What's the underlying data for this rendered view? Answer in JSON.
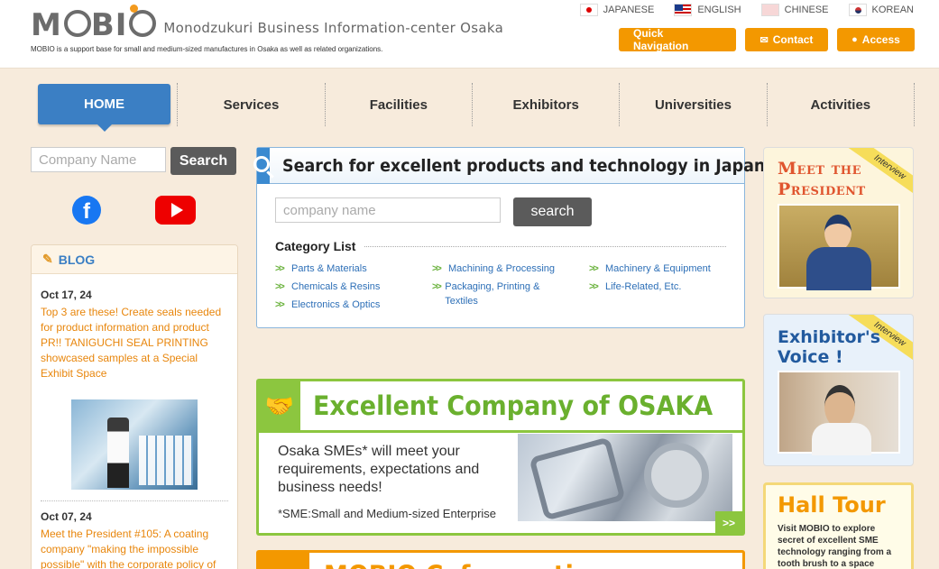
{
  "header": {
    "logo_text": "MOBIO",
    "org_name": "Monodzukuri Business Information-center Osaka",
    "tagline": "MOBIO is a support base for small and medium-sized manufactures in Osaka as well as related organizations.",
    "languages": [
      {
        "label": "JAPANESE",
        "flag": "jp-flag-icon"
      },
      {
        "label": "ENGLISH",
        "flag": "us-flag-icon"
      },
      {
        "label": "CHINESE",
        "flag": "cn-flag-icon"
      },
      {
        "label": "KOREAN",
        "flag": "kr-flag-icon"
      }
    ],
    "buttons": {
      "quick_nav": "Quick Navigation",
      "contact": "Contact",
      "access": "Access"
    }
  },
  "nav": {
    "items": [
      "HOME",
      "Services",
      "Facilities",
      "Exhibitors",
      "Universities",
      "Activities"
    ]
  },
  "left": {
    "search_placeholder": "Company Name",
    "search_button": "Search",
    "blog_title": "BLOG",
    "posts": [
      {
        "date": "Oct 17, 24",
        "text": "Top 3 are these! Create seals needed for product information and product PR!! TANIGUCHI SEAL PRINTING showcased samples at a Special Exhibit Space"
      },
      {
        "date": "Oct 07, 24",
        "text": "Meet the President #105: A coating company \"making the impossible possible\" with the corporate policy of \"hatjo to mono tsukuri ni ikkodzukuri\""
      }
    ]
  },
  "center": {
    "search_title": "Search for excellent products and technology in Japan",
    "search_placeholder": "company name",
    "search_button": "search",
    "category_title": "Category List",
    "categories": [
      "Parts & Materials",
      "Machining & Processing",
      "Machinery & Equipment",
      "Chemicals & Resins",
      "Packaging, Printing & Textiles",
      "Life-Related, Etc.",
      "Electronics & Optics"
    ],
    "osaka_banner": {
      "title": "Excellent Company of OSAKA",
      "text": "Osaka SMEs* will meet your requirements, expectations and business needs!",
      "note": "*SME:Small and Medium-sized Enterprise",
      "more": ">>"
    },
    "cafe_banner": {
      "title": "MOBIO Cafe meeting"
    }
  },
  "right": {
    "president": {
      "ribbon": "Interview",
      "title_line1": "Meet the",
      "title_line2": "President"
    },
    "voice": {
      "ribbon": "Interview",
      "title_line1": "Exhibitor's",
      "title_line2": "Voice !"
    },
    "hall": {
      "title": "Hall Tour",
      "text": "Visit MOBIO to explore secret of excellent SME technology ranging from a tooth brush to a space satellite."
    }
  },
  "colors": {
    "accent_orange": "#f39800",
    "nav_blue": "#3b7fc4",
    "link_blue": "#2d6fb7",
    "banner_green": "#8cc63f",
    "page_bg": "#f7ebdc"
  }
}
